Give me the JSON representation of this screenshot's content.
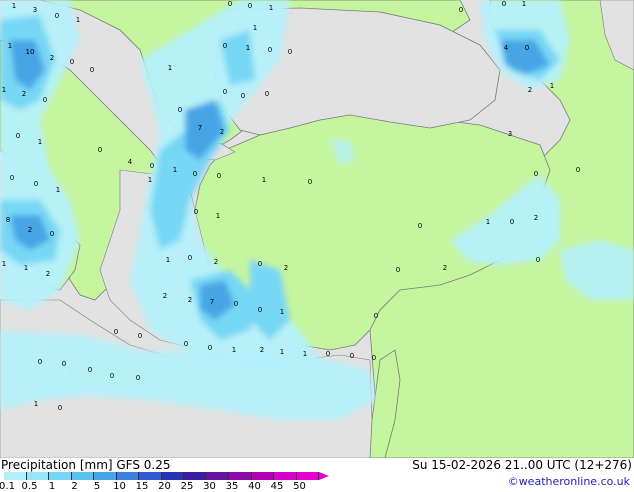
{
  "header": {
    "title": "Precipitation [mm]  GFS 0.25",
    "valid_time": "Su 15-02-2026 21..00 UTC (12+276)",
    "credit": "©weatheronline.co.uk"
  },
  "legend": {
    "labels": [
      "0.1",
      "0.5",
      "1",
      "2",
      "5",
      "10",
      "15",
      "20",
      "25",
      "30",
      "35",
      "40",
      "45",
      "50"
    ],
    "colors": [
      "#b4f0fa",
      "#96e6fa",
      "#78d7f5",
      "#5ac3f0",
      "#46a5e6",
      "#3c82dc",
      "#325ad2",
      "#2832b4",
      "#3c1ea0",
      "#6414a0",
      "#8c0aaa",
      "#b400b4",
      "#d200c8",
      "#e600d2"
    ]
  },
  "colors": {
    "sea": "#e2e2e2",
    "land": "#c6f5a0",
    "precip_light": "#b4f0fa",
    "precip_medium": "#78d7f5",
    "precip_heavy": "#46a5e6"
  },
  "map_labels": [
    "1",
    "3",
    "0",
    "1",
    "0",
    "0",
    "1",
    "0",
    "0",
    "1",
    "1",
    "10",
    "2",
    "0",
    "0",
    "0",
    "1",
    "0",
    "0",
    "4",
    "0",
    "2",
    "0",
    "1",
    "1",
    "1",
    "0",
    "0",
    "7",
    "2",
    "0",
    "0",
    "2",
    "1",
    "0",
    "1",
    "0",
    "3",
    "1",
    "0",
    "0",
    "0",
    "1",
    "0",
    "8",
    "2",
    "0",
    "4",
    "0",
    "1",
    "0",
    "0",
    "1",
    "0",
    "2",
    "1",
    "1",
    "2",
    "1",
    "0",
    "1",
    "2",
    "2",
    "7",
    "0",
    "0",
    "1",
    "0",
    "2",
    "2",
    "2",
    "1",
    "1",
    "0",
    "0",
    "0",
    "0",
    "1",
    "0",
    "2",
    "0",
    "0",
    "0",
    "0",
    "0",
    "0",
    "1",
    "0",
    "0",
    "0",
    "0",
    "0",
    "1",
    "0",
    "0",
    "0"
  ]
}
